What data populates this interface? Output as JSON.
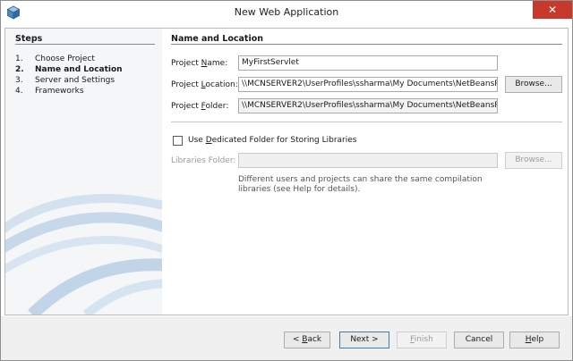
{
  "window": {
    "title": "New Web Application",
    "close_glyph": "✕"
  },
  "steps": {
    "heading": "Steps",
    "items": [
      {
        "num": "1.",
        "label": "Choose Project"
      },
      {
        "num": "2.",
        "label": "Name and Location"
      },
      {
        "num": "3.",
        "label": "Server and Settings"
      },
      {
        "num": "4.",
        "label": "Frameworks"
      }
    ],
    "current_index": 1
  },
  "section": {
    "title": "Name and Location"
  },
  "form": {
    "project_name": {
      "label_pre": "Project ",
      "label_mn": "N",
      "label_post": "ame:",
      "value": "MyFirstServlet"
    },
    "project_location": {
      "label_pre": "Project ",
      "label_mn": "L",
      "label_post": "ocation:",
      "value": "\\\\MCNSERVER2\\UserProfiles\\ssharma\\My Documents\\NetBeansProj"
    },
    "project_folder": {
      "label_pre": "Project ",
      "label_mn": "F",
      "label_post": "older:",
      "value": "\\\\MCNSERVER2\\UserProfiles\\ssharma\\My Documents\\NetBeansProj"
    },
    "browse_label": "Browse...",
    "dedicated_folder": {
      "label_pre": "Use ",
      "label_mn": "D",
      "label_post": "edicated Folder for Storing Libraries",
      "checked": false
    },
    "libraries_folder": {
      "label": "Libraries Folder:",
      "value": ""
    },
    "libraries_browse_label": "Browse...",
    "help_line1": "Different users and projects can share the same compilation",
    "help_line2": "libraries (see Help for details)."
  },
  "buttons": {
    "back": {
      "pre": "< ",
      "mn": "B",
      "post": "ack"
    },
    "next": {
      "label": "Next >"
    },
    "finish": {
      "mn": "F",
      "post": "inish"
    },
    "cancel": {
      "label": "Cancel"
    },
    "help": {
      "mn": "H",
      "post": "elp"
    }
  },
  "colors": {
    "close_button": "#c7392b",
    "focus_border": "#3c7fb1"
  }
}
